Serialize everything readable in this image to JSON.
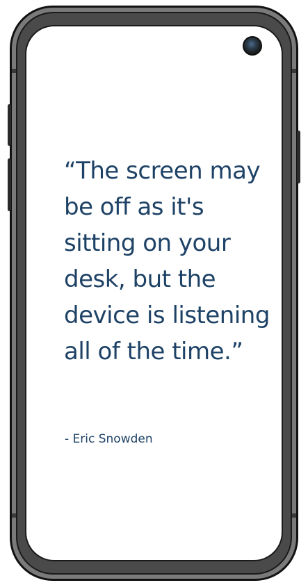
{
  "quote": {
    "text": "“The screen may be off as it's sitting on your desk, but the device is listening all of the time.”",
    "author": "- Eric Snowden"
  },
  "colors": {
    "text": "#1e4266",
    "screen": "#ffffff",
    "frame": "#7a7a7a"
  },
  "icons": {
    "camera": "front-camera-icon"
  }
}
